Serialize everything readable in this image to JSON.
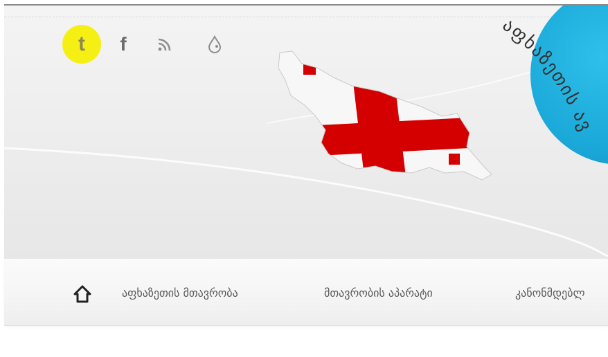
{
  "header": {
    "curved_title": "აფხაზეთის ავ",
    "social": [
      {
        "name": "twitter-icon",
        "glyph": "t"
      },
      {
        "name": "facebook-icon",
        "glyph": "f"
      },
      {
        "name": "rss-icon"
      },
      {
        "name": "drop-icon"
      }
    ],
    "colors": {
      "twitter_highlight": "#f6ef14",
      "circle": "#1aa8d8",
      "flag_red": "#d40000",
      "flag_white": "#ffffff"
    }
  },
  "nav": {
    "items": [
      {
        "label": "აფხაზეთის მთავრობა"
      },
      {
        "label": "მთავრობის აპარატი"
      },
      {
        "label": "კანონმდებლ"
      }
    ]
  }
}
